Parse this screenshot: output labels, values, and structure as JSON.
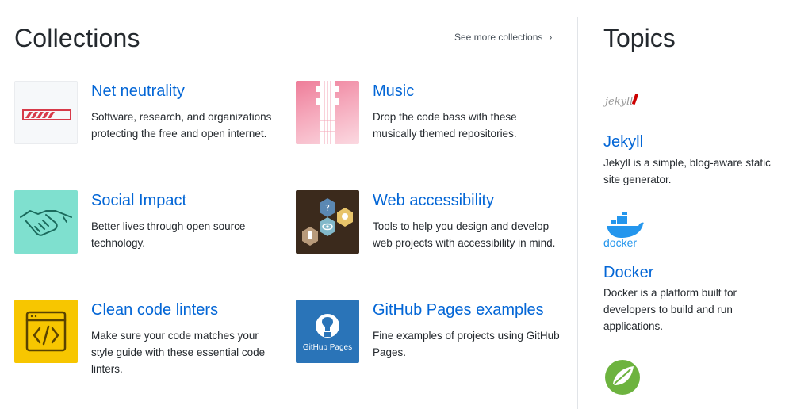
{
  "collections": {
    "title": "Collections",
    "see_more": "See more collections",
    "items": [
      {
        "title": "Net neutrality",
        "description": "Software, research, and organizations protecting the free and open internet.",
        "icon": "progress-bar-icon"
      },
      {
        "title": "Music",
        "description": "Drop the code bass with these musically themed repositories.",
        "icon": "guitar-icon"
      },
      {
        "title": "Social Impact",
        "description": "Better lives through open source technology.",
        "icon": "handshake-icon"
      },
      {
        "title": "Web accessibility",
        "description": "Tools to help you design and develop web projects with accessibility in mind.",
        "icon": "accessibility-hexagons-icon"
      },
      {
        "title": "Clean code linters",
        "description": "Make sure your code matches your style guide with these essential code linters.",
        "icon": "code-window-icon"
      },
      {
        "title": "GitHub Pages examples",
        "description": "Fine examples of projects using GitHub Pages.",
        "icon": "github-pages-icon",
        "logo_text": "GitHub Pages"
      }
    ]
  },
  "topics": {
    "title": "Topics",
    "items": [
      {
        "title": "Jekyll",
        "description": "Jekyll is a simple, blog-aware static site generator.",
        "icon": "jekyll-logo",
        "logo_text": "jekyll"
      },
      {
        "title": "Docker",
        "description": "Docker is a platform built for developers to build and run applications.",
        "icon": "docker-logo",
        "logo_text": "docker"
      },
      {
        "title": "",
        "description": "",
        "icon": "spring-logo"
      }
    ]
  },
  "colors": {
    "link": "#0366d6",
    "text": "#24292e",
    "net_neutrality_red": "#d73a49",
    "social_impact_teal": "#7fe0cf",
    "linters_yellow": "#f7c600",
    "github_pages_blue": "#2a74b8",
    "docker_blue": "#2496ed",
    "spring_green": "#6db33f"
  }
}
